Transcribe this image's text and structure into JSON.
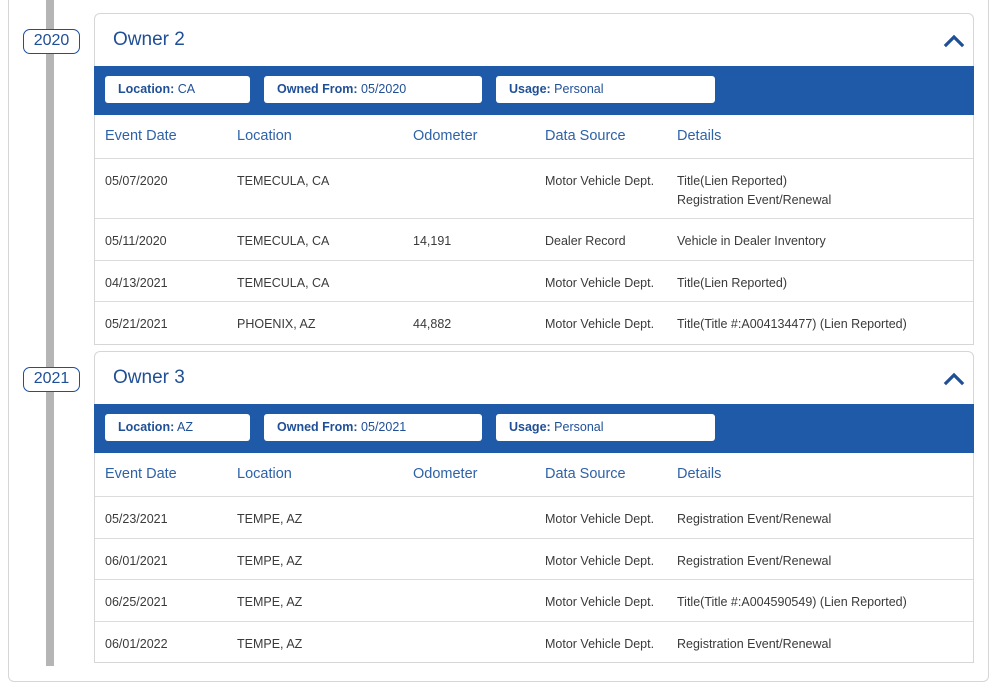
{
  "timeline": {
    "years": [
      "2020",
      "2021"
    ]
  },
  "owners": [
    {
      "title": "Owner 2",
      "chips": [
        {
          "label": "Location:",
          "value": "CA"
        },
        {
          "label": "Owned From:",
          "value": "05/2020"
        },
        {
          "label": "Usage:",
          "value": "Personal"
        }
      ],
      "columns": [
        "Event Date",
        "Location",
        "Odometer",
        "Data Source",
        "Details"
      ],
      "rows": [
        {
          "date": "05/07/2020",
          "location": "TEMECULA, CA",
          "odometer": "",
          "source": "Motor Vehicle Dept.",
          "details": [
            "Title(Lien Reported)",
            "Registration Event/Renewal"
          ]
        },
        {
          "date": "05/11/2020",
          "location": "TEMECULA, CA",
          "odometer": "14,191",
          "source": "Dealer Record",
          "details": [
            "Vehicle in Dealer Inventory"
          ]
        },
        {
          "date": "04/13/2021",
          "location": "TEMECULA, CA",
          "odometer": "",
          "source": "Motor Vehicle Dept.",
          "details": [
            "Title(Lien Reported)"
          ]
        },
        {
          "date": "05/21/2021",
          "location": "PHOENIX, AZ",
          "odometer": "44,882",
          "source": "Motor Vehicle Dept.",
          "details": [
            "Title(Title #:A004134477) (Lien Reported)"
          ]
        }
      ]
    },
    {
      "title": "Owner 3",
      "chips": [
        {
          "label": "Location:",
          "value": "AZ"
        },
        {
          "label": "Owned From:",
          "value": "05/2021"
        },
        {
          "label": "Usage:",
          "value": "Personal"
        }
      ],
      "columns": [
        "Event Date",
        "Location",
        "Odometer",
        "Data Source",
        "Details"
      ],
      "rows": [
        {
          "date": "05/23/2021",
          "location": "TEMPE, AZ",
          "odometer": "",
          "source": "Motor Vehicle Dept.",
          "details": [
            "Registration Event/Renewal"
          ]
        },
        {
          "date": "06/01/2021",
          "location": "TEMPE, AZ",
          "odometer": "",
          "source": "Motor Vehicle Dept.",
          "details": [
            "Registration Event/Renewal"
          ]
        },
        {
          "date": "06/25/2021",
          "location": "TEMPE, AZ",
          "odometer": "",
          "source": "Motor Vehicle Dept.",
          "details": [
            "Title(Title #:A004590549) (Lien Reported)"
          ]
        },
        {
          "date": "06/01/2022",
          "location": "TEMPE, AZ",
          "odometer": "",
          "source": "Motor Vehicle Dept.",
          "details": [
            "Registration Event/Renewal"
          ]
        }
      ]
    }
  ],
  "colors": {
    "accent": "#1f5aa8",
    "heading": "#1f4f96",
    "timeline": "#b5b5b5"
  },
  "icons": {
    "collapse": "chevron-up-icon"
  }
}
